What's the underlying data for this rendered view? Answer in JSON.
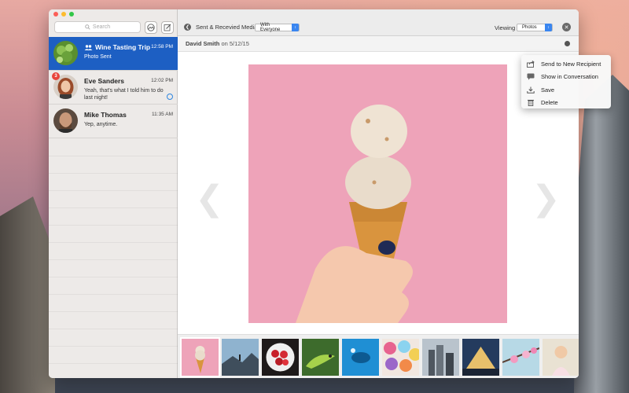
{
  "sidebar": {
    "search_placeholder": "Search",
    "conversations": [
      {
        "name": "Wine Tasting Trip",
        "time": "12:58 PM",
        "preview": "Photo Sent",
        "active": true
      },
      {
        "name": "Eve Sanders",
        "time": "12:02 PM",
        "preview": "Yeah, that's what I told him to do last night!",
        "badge": "3"
      },
      {
        "name": "Mike Thomas",
        "time": "11:35 AM",
        "preview": "Yep, anytime."
      }
    ]
  },
  "toolbar": {
    "title": "Sent & Recevied Media",
    "share_filter": "With Everyone",
    "viewing_label": "Viewing",
    "viewing_value": "Photos"
  },
  "info": {
    "author": "David Smith",
    "date_text": "on 5/12/15"
  },
  "menu": {
    "items": [
      {
        "label": "Send to New Recipient",
        "icon": "share-icon"
      },
      {
        "label": "Show in Conversation",
        "icon": "speech-bubble-icon"
      },
      {
        "label": "Save",
        "icon": "download-icon"
      },
      {
        "label": "Delete",
        "icon": "trash-icon"
      }
    ]
  },
  "colors": {
    "accent": "#1d5fc3",
    "badge": "#e8443a",
    "select_arrow": "#3a86f0"
  }
}
